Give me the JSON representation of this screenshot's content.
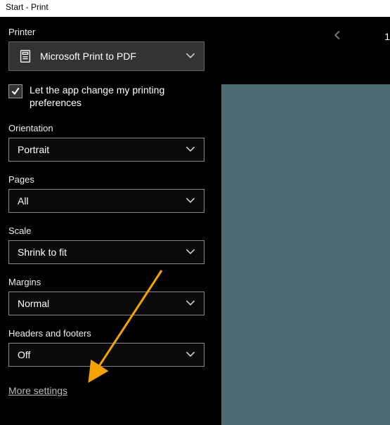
{
  "titlebar": "Start - Print",
  "pager": {
    "current": "1"
  },
  "printer": {
    "label": "Printer",
    "selected": "Microsoft Print to PDF"
  },
  "checkbox": {
    "label": "Let the app change my printing preferences",
    "checked": true
  },
  "orientation": {
    "label": "Orientation",
    "selected": "Portrait"
  },
  "pages": {
    "label": "Pages",
    "selected": "All"
  },
  "scale": {
    "label": "Scale",
    "selected": "Shrink to fit"
  },
  "margins": {
    "label": "Margins",
    "selected": "Normal"
  },
  "headers": {
    "label": "Headers and footers",
    "selected": "Off"
  },
  "more_settings": "More settings"
}
